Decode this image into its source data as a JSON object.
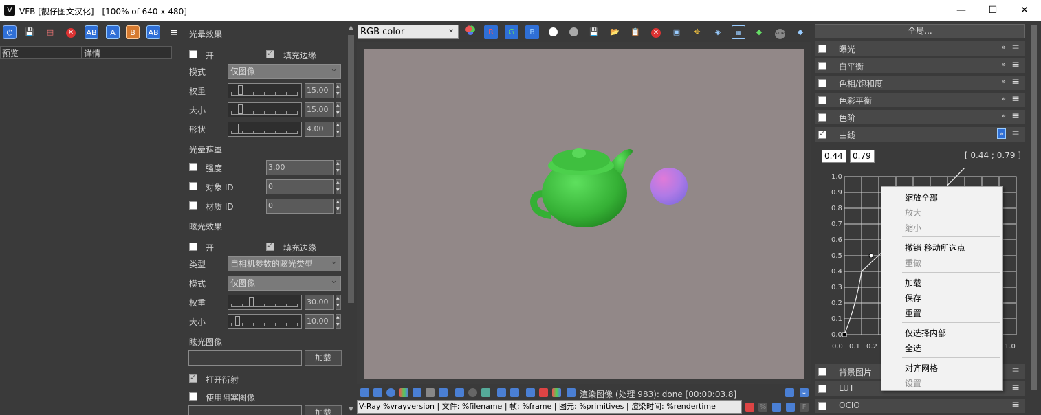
{
  "window": {
    "title": "VFB [靓仔图文汉化] - [100% of 640 x 480]",
    "minimize": "—",
    "maximize": "☐",
    "close": "✕"
  },
  "left_panel": {
    "list_columns": [
      "预览",
      "详情"
    ]
  },
  "props": {
    "glare_section": "光晕效果",
    "glare_on": "开",
    "glare_fill_edges": "填充边缘",
    "mode_label": "模式",
    "mode_value": "仅图像",
    "weight_label": "权重",
    "weight_value": "15.00",
    "size_label": "大小",
    "size_value": "15.00",
    "shape_label": "形状",
    "shape_value": "4.00",
    "glare_mask_section": "光晕遮罩",
    "intensity_label": "强度",
    "intensity_value": "3.00",
    "object_id_label": "对象 ID",
    "object_id_value": "0",
    "material_id_label": "材质 ID",
    "material_id_value": "0",
    "bloom_section": "眩光效果",
    "bloom_on": "开",
    "bloom_fill_edges": "填充边缘",
    "type_label": "类型",
    "type_value": "自相机参数的眩光类型",
    "bloom_mode_label": "模式",
    "bloom_mode_value": "仅图像",
    "bloom_weight_label": "权重",
    "bloom_weight_value": "30.00",
    "bloom_size_label": "大小",
    "bloom_size_value": "10.00",
    "bloom_image_label": "眩光图像",
    "load_button": "加载",
    "open_diffraction": "打开衍射",
    "use_obstacle": "使用阻塞图像",
    "load_button2": "加载"
  },
  "viewer": {
    "channel": "RGB color",
    "status": "渲染图像 (处理 983): done [00:00:03.8]",
    "stamp": "V-Ray %vrayversion | 文件: %filename | 帧: %frame | 图元: %primitives | 渲染时间: %rendertime"
  },
  "color_correction": {
    "global_button": "全局...",
    "layers": [
      {
        "label": "曝光",
        "checked": false
      },
      {
        "label": "白平衡",
        "checked": false
      },
      {
        "label": "色相/饱和度",
        "checked": false
      },
      {
        "label": "色彩平衡",
        "checked": false
      },
      {
        "label": "色阶",
        "checked": false
      },
      {
        "label": "曲线",
        "checked": true
      }
    ],
    "curve_x": "0.44",
    "curve_y": "0.79",
    "curve_readout": "[ 0.44 ; 0.79 ]",
    "y_ticks": [
      "1.0",
      "0.9",
      "0.8",
      "0.7",
      "0.6",
      "0.5",
      "0.4",
      "0.3",
      "0.2",
      "0.1",
      "0.0"
    ],
    "x_ticks": [
      "0.0",
      "0.1",
      "0.2",
      "1.0"
    ],
    "lower_layers": [
      {
        "label": "背景图片"
      },
      {
        "label": "LUT"
      },
      {
        "label": "OCIO"
      }
    ]
  },
  "context_menu": {
    "items": [
      {
        "label": "缩放全部",
        "enabled": true
      },
      {
        "label": "放大",
        "enabled": false
      },
      {
        "label": "缩小",
        "enabled": false
      },
      {
        "label": "撤销 移动所选点",
        "enabled": true
      },
      {
        "label": "重做",
        "enabled": false
      },
      {
        "label": "加载",
        "enabled": true
      },
      {
        "label": "保存",
        "enabled": true
      },
      {
        "label": "重置",
        "enabled": true
      },
      {
        "label": "仅选择内部",
        "enabled": true
      },
      {
        "label": "全选",
        "enabled": true
      },
      {
        "label": "对齐网格",
        "enabled": true
      },
      {
        "label": "设置",
        "enabled": false
      }
    ]
  },
  "colors": {
    "render_background": "#928888",
    "teapot": "#3fc23f",
    "sphere": "#b67ae6",
    "accent_blue": "#2f6fd6"
  }
}
